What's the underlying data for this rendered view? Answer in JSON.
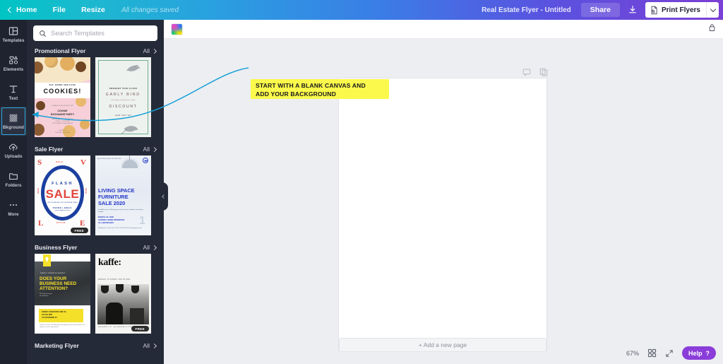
{
  "topbar": {
    "home_label": "Home",
    "file_label": "File",
    "resize_label": "Resize",
    "saved_status": "All changes saved",
    "doc_title": "Real Estate Flyer - Untitled",
    "share_label": "Share",
    "download_icon": "download-icon",
    "print_label": "Print Flyers",
    "print_caret_icon": "chevron-down-icon",
    "back_icon": "chevron-left-icon"
  },
  "rail": {
    "items": [
      {
        "label": "Templates",
        "icon": "templates-icon",
        "active": false
      },
      {
        "label": "Elements",
        "icon": "elements-icon",
        "active": false
      },
      {
        "label": "Text",
        "icon": "text-icon",
        "active": false
      },
      {
        "label": "Bkground",
        "icon": "background-icon",
        "active": true
      },
      {
        "label": "Uploads",
        "icon": "uploads-icon",
        "active": false
      },
      {
        "label": "Folders",
        "icon": "folders-icon",
        "active": false
      },
      {
        "label": "More",
        "icon": "more-icon",
        "active": false
      }
    ]
  },
  "panel": {
    "search": {
      "placeholder": "Search Templates",
      "value": "",
      "icon": "search-icon"
    },
    "all_label": "All",
    "sections": [
      {
        "title": "Promotional Flyer",
        "templates": [
          {
            "name": "cookies-flyer",
            "kicker": "EAT, DRINK AND HAVE",
            "headline": "COOKIES!",
            "sub1": "PLEASE JOIN US FOR OUR",
            "sub2": "COOKIE",
            "sub3": "EXCHANGE PARTY",
            "detail1": "SATURDAY, DECEMBER 14",
            "detail2": "ONE TO FOUR PM",
            "detail3": "1234 SWEET OAK AVENUE",
            "detail4": "RALEIGH, NC 27601",
            "footer1": "RSVP TO",
            "footer2": "JUSTINE, 555-0199",
            "free_badge": ""
          },
          {
            "name": "early-bird-flyer",
            "kicker": "PRESENT THIS FLYER",
            "headline": "EARLY  BIRD",
            "sub1": "50% off your next 80 print hrs + More",
            "sub2": "DISCOUNT",
            "sub3": "AND GET AN",
            "free_badge": ""
          }
        ]
      },
      {
        "title": "Sale Flyer",
        "templates": [
          {
            "name": "flash-sale-flyer",
            "kicker": "FLASH",
            "headline": "SALE",
            "sub1": "GET 50 PERCENT OFF ON SPECIAL ITEMS",
            "sub2": "PHONE  |  EMAIL",
            "sub3": "www.reallygreatsite.com",
            "corner_text": "SALE",
            "free_badge": "FREE"
          },
          {
            "name": "living-space-furniture-flyer",
            "kicker": "AURORA HOME INTERIORS",
            "headline1": "LIVING SPACE",
            "headline2": "FURNITURE",
            "headline3": "SALE 2020",
            "sub1": "Incredible prices on all living spaces and our classic collection. Free delivery included.",
            "detail1": "MARCH 19, 2020",
            "detail2": "AURORA HOME INTERIORS",
            "detail3": "ALL BRANCHES",
            "footer": "1234 Anywhere St., Any City, ST 12345  |  123-456-7890  |  hello@reallygreatsite.com",
            "pro_badge": "pro-crown-icon",
            "free_badge": ""
          }
        ]
      },
      {
        "title": "Business Flyer",
        "templates": [
          {
            "name": "business-attention-flyer",
            "kicker": "DIRECT CREATIVE AGENCY",
            "headline1": "DOES YOUR",
            "headline2": "BUSINESS NEED",
            "headline3": "ATTENTION?",
            "sub1": "We help brands grow",
            "sub2": "with bold ideas",
            "box1": "SUNDAY CREATIONS AND CO.",
            "box2": "123-456-7890",
            "box3": "CO ANYWHERE ST",
            "footer": "We pride ourselves on building brands by telling your story to your audience and helping it reach the right potential.",
            "bulb_icon": "lightbulb-icon",
            "free_badge": ""
          },
          {
            "name": "kaffe-flyer",
            "headline": "kaffe:",
            "sub1": "MONDAY TO FRIDAY 7AM TO 5PM",
            "footer1": "UNIVERSITY ST.",
            "footer2": "BIG AVENUE 14 27601",
            "free_badge": "FREE"
          }
        ]
      },
      {
        "title": "Marketing Flyer",
        "templates": []
      }
    ]
  },
  "workspace": {
    "background_swatch_icon": "background-color-swatch",
    "lock_icon": "lock-icon",
    "page_tools": [
      {
        "icon": "comment-icon"
      },
      {
        "icon": "duplicate-page-icon"
      }
    ],
    "annotation": {
      "line1": "START WITH A BLANK CANVAS AND",
      "line2": "ADD YOUR BACKGROUND",
      "color": "#FBF94B",
      "arrow_color": "#18A0D8"
    },
    "add_page_label": "+ Add a new page",
    "zoom_level": "67%",
    "grid_icon": "grid-view-icon",
    "expand_icon": "fullscreen-icon",
    "help_label": "Help",
    "help_icon": "question-mark-icon"
  }
}
